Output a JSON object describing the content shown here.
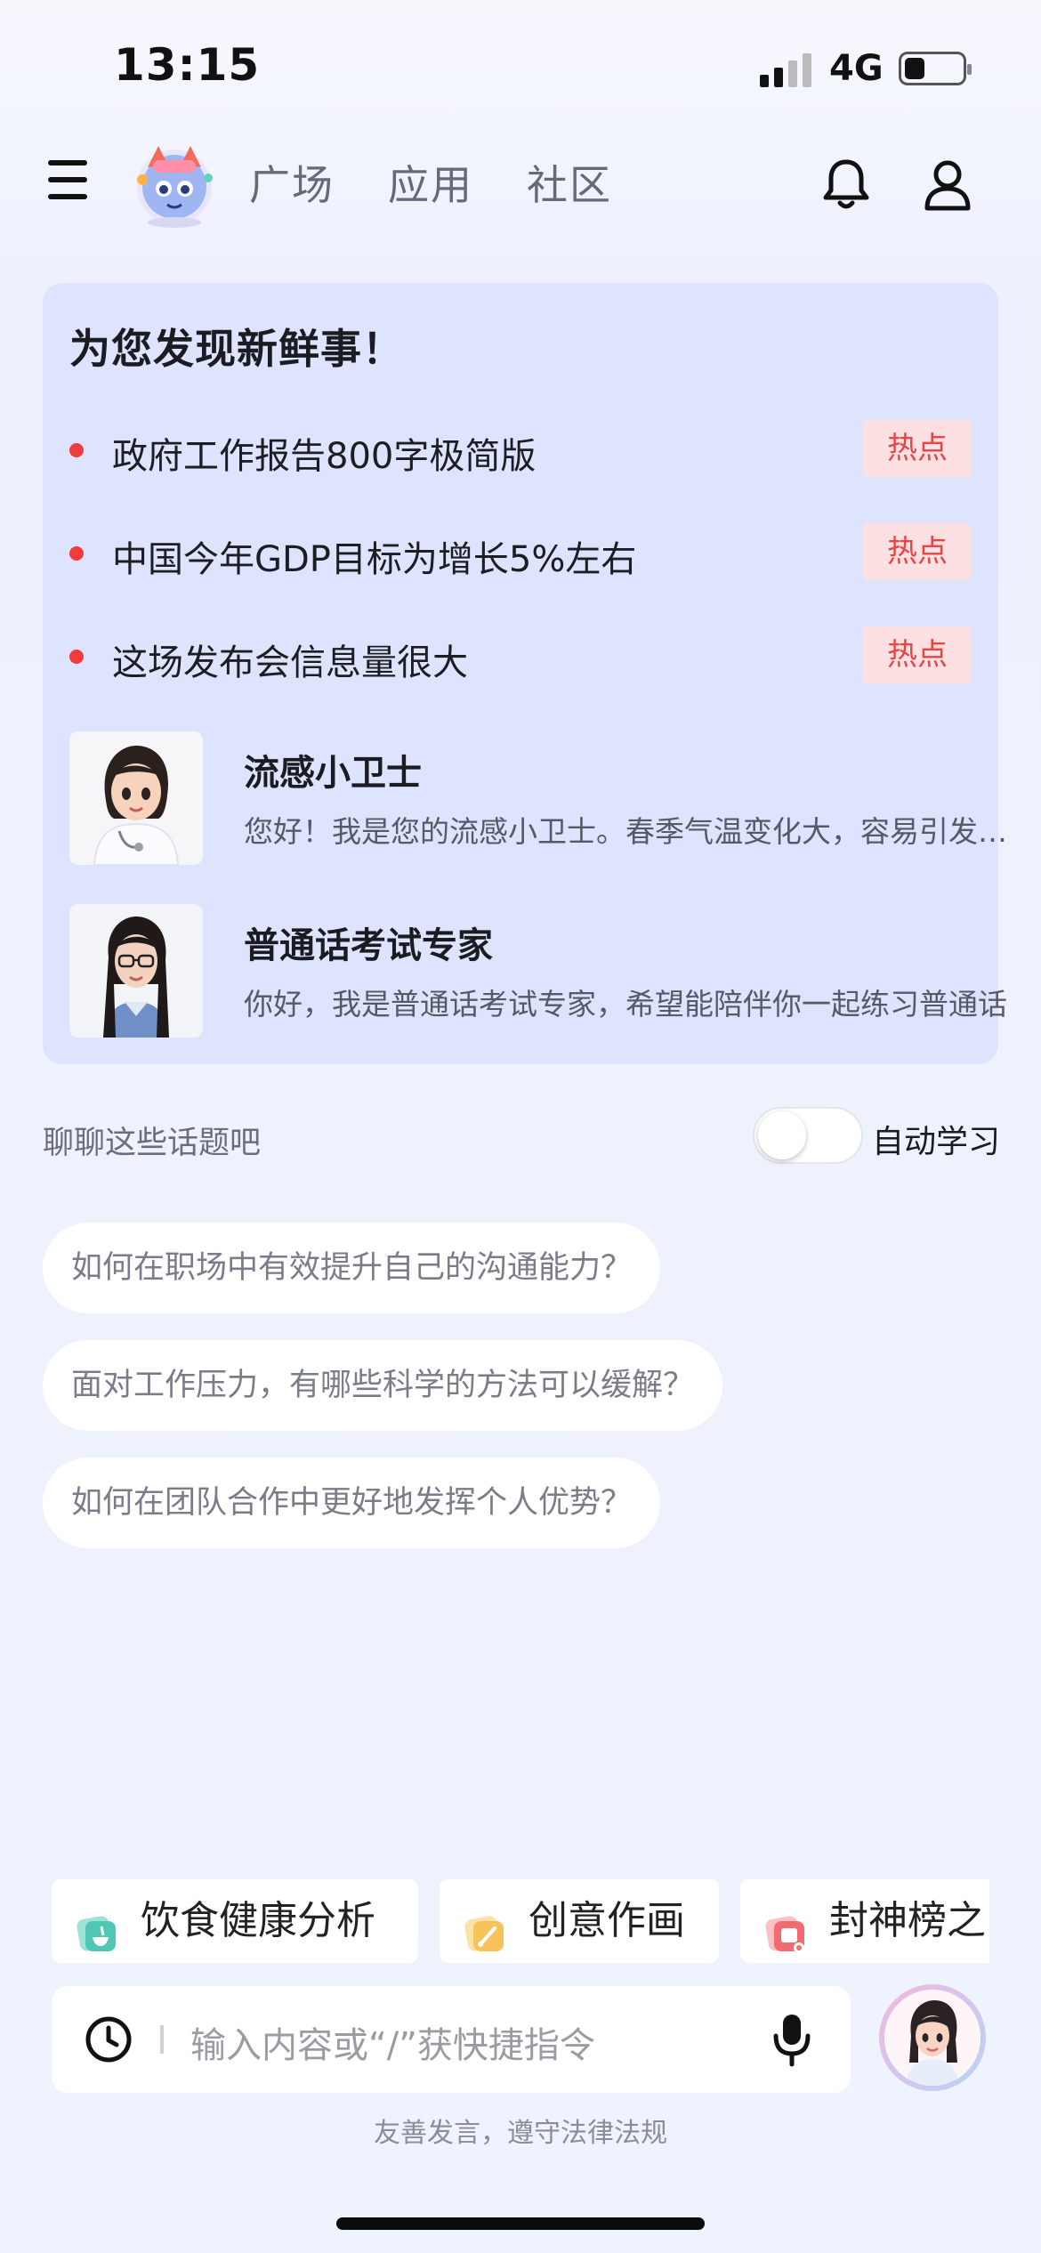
{
  "status": {
    "time": "13:15",
    "network": "4G",
    "battery_level": 0.35
  },
  "nav": {
    "tabs": [
      "广场",
      "应用",
      "社区"
    ]
  },
  "discover": {
    "title": "为您发现新鲜事！",
    "hot_items": [
      {
        "text": "政府工作报告800字极简版",
        "badge": "热点"
      },
      {
        "text": "中国今年GDP目标为增长5%左右",
        "badge": "热点"
      },
      {
        "text": "这场发布会信息量很大",
        "badge": "热点"
      }
    ],
    "agents": [
      {
        "name": "流感小卫士",
        "desc": "您好！我是您的流感小卫士。春季气温变化大，容易引发流感，有什么问题都可以问我"
      },
      {
        "name": "普通话考试专家",
        "desc": "你好，我是普通话考试专家，希望能陪伴你一起练习普通话"
      }
    ]
  },
  "topics": {
    "label": "聊聊这些话题吧",
    "auto_learn_label": "自动学习",
    "auto_learn_on": false,
    "suggestions": [
      "如何在职场中有效提升自己的沟通能力？",
      "面对工作压力，有哪些科学的方法可以缓解？",
      "如何在团队合作中更好地发挥个人优势？"
    ]
  },
  "quick_actions": [
    {
      "label": "饮食健康分析",
      "icon": "food-icon",
      "color": "#4fc7b4"
    },
    {
      "label": "创意作画",
      "icon": "paint-icon",
      "color": "#f5c35a"
    },
    {
      "label": "封神榜之",
      "icon": "scroll-icon",
      "color": "#f26b72"
    }
  ],
  "input": {
    "placeholder": "输入内容或“/”获快捷指令"
  },
  "footer": {
    "note": "友善发言，遵守法律法规"
  }
}
